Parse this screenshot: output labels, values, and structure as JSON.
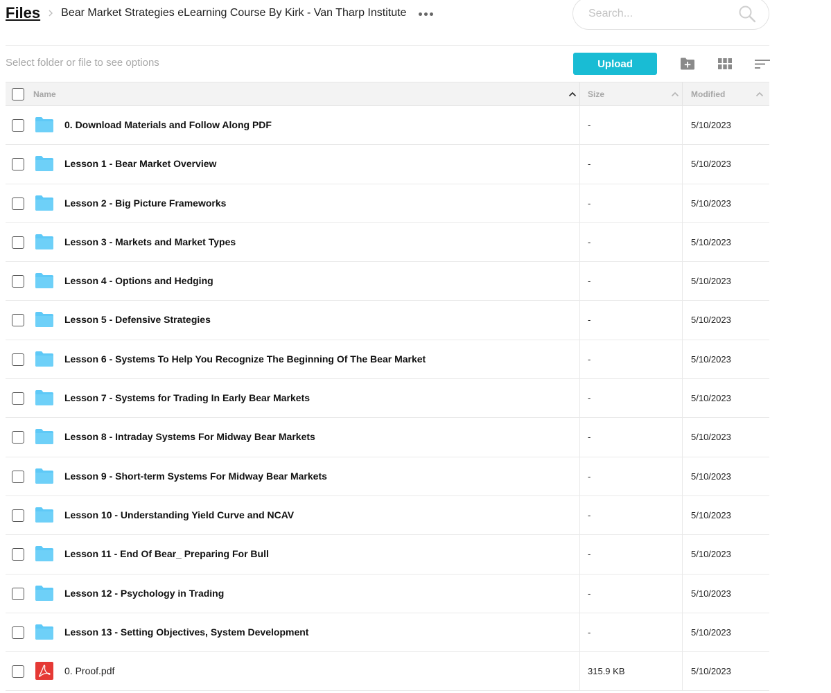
{
  "breadcrumb": {
    "root": "Files",
    "current": "Bear Market Strategies eLearning Course By Kirk - Van Tharp Institute"
  },
  "search": {
    "placeholder": "Search...",
    "value": ""
  },
  "toolbar": {
    "hint": "Select folder or file to see options",
    "upload_label": "Upload"
  },
  "table": {
    "columns": {
      "name": "Name",
      "size": "Size",
      "modified": "Modified"
    },
    "rows": [
      {
        "type": "folder",
        "name": "0. Download Materials and Follow Along PDF",
        "size": "-",
        "modified": "5/10/2023"
      },
      {
        "type": "folder",
        "name": "Lesson 1 - Bear Market Overview",
        "size": "-",
        "modified": "5/10/2023"
      },
      {
        "type": "folder",
        "name": "Lesson 2 - Big Picture Frameworks",
        "size": "-",
        "modified": "5/10/2023"
      },
      {
        "type": "folder",
        "name": "Lesson 3 - Markets and Market Types",
        "size": "-",
        "modified": "5/10/2023"
      },
      {
        "type": "folder",
        "name": "Lesson 4 - Options and Hedging",
        "size": "-",
        "modified": "5/10/2023"
      },
      {
        "type": "folder",
        "name": "Lesson 5 - Defensive Strategies",
        "size": "-",
        "modified": "5/10/2023"
      },
      {
        "type": "folder",
        "name": "Lesson 6 - Systems To Help You Recognize The Beginning Of The Bear Market",
        "size": "-",
        "modified": "5/10/2023"
      },
      {
        "type": "folder",
        "name": "Lesson 7 - Systems for Trading In Early Bear Markets",
        "size": "-",
        "modified": "5/10/2023"
      },
      {
        "type": "folder",
        "name": "Lesson 8 - Intraday Systems For Midway Bear Markets",
        "size": "-",
        "modified": "5/10/2023"
      },
      {
        "type": "folder",
        "name": "Lesson 9 - Short-term Systems For Midway Bear Markets",
        "size": "-",
        "modified": "5/10/2023"
      },
      {
        "type": "folder",
        "name": "Lesson 10 - Understanding Yield Curve and NCAV",
        "size": "-",
        "modified": "5/10/2023"
      },
      {
        "type": "folder",
        "name": "Lesson 11 - End Of Bear_ Preparing For Bull",
        "size": "-",
        "modified": "5/10/2023"
      },
      {
        "type": "folder",
        "name": "Lesson 12 - Psychology in Trading",
        "size": "-",
        "modified": "5/10/2023"
      },
      {
        "type": "folder",
        "name": "Lesson 13 - Setting Objectives, System Development",
        "size": "-",
        "modified": "5/10/2023"
      },
      {
        "type": "pdf",
        "name": "0. Proof.pdf",
        "size": "315.9 KB",
        "modified": "5/10/2023"
      }
    ]
  },
  "icons": {
    "folder": "folder-icon",
    "pdf": "pdf-icon",
    "search": "search-icon",
    "new_folder": "new-folder-icon",
    "grid": "grid-view-icon",
    "sort": "sort-icon",
    "more": "more-icon"
  },
  "colors": {
    "accent": "#19bcd4",
    "folder": "#5ec9f7",
    "pdf": "#e53935"
  }
}
